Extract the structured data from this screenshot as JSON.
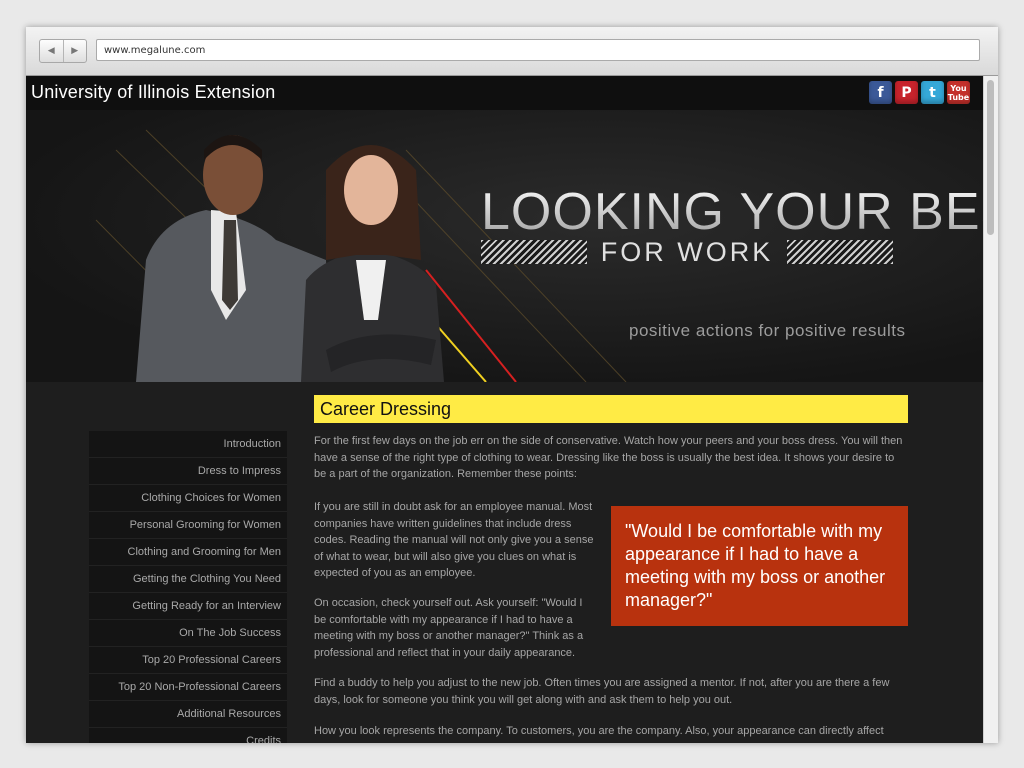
{
  "browser": {
    "url": "www.megalune.com",
    "back_glyph": "◀",
    "forward_glyph": "▶"
  },
  "header": {
    "site_title": "University of Illinois Extension",
    "social": [
      {
        "name": "facebook-icon",
        "glyph": "f",
        "color": "#3b5998"
      },
      {
        "name": "pinterest-icon",
        "glyph": "P",
        "color": "#c8232c"
      },
      {
        "name": "twitter-icon",
        "glyph": "t",
        "color": "#35a8d8"
      },
      {
        "name": "youtube-icon",
        "glyph_top": "You",
        "glyph_bottom": "Tube",
        "color": "#c4302b"
      }
    ]
  },
  "hero": {
    "title": "LOOKING YOUR BEST",
    "subtitle": "FOR WORK",
    "tagline": "positive actions for positive results"
  },
  "sidebar": {
    "items": [
      "Introduction",
      "Dress to Impress",
      "Clothing Choices for Women",
      "Personal Grooming for Women",
      "Clothing and Grooming for Men",
      "Getting the Clothing You Need",
      "Getting Ready for an Interview",
      "On The Job Success",
      "Top 20 Professional Careers",
      "Top 20 Non-Professional Careers",
      "Additional Resources",
      "Credits"
    ]
  },
  "content": {
    "heading": "Career Dressing",
    "p1": "For the first few days on the job err on the side of conservative. Watch how your peers and your boss dress. You will then have a sense of the right type of clothing to wear. Dressing like the boss is usually the best idea. It shows your desire to be a part of the organization. Remember these points:",
    "p2": "If you are still in doubt ask for an employee manual. Most companies have written guidelines that include dress codes. Reading the manual will not only give you a sense of what to wear, but will also give you clues on what is expected of you as an employee.",
    "p3": "On occasion, check yourself out. Ask yourself: \"Would I be comfortable with my appearance if I had to have a meeting with my boss or another manager?\" Think as a professional and reflect that in your daily appearance.",
    "quote": "\"Would I be comfortable with my appearance if I had to have a meeting with my boss or another manager?\"",
    "p4": "Find a buddy to help you adjust to the new job. Often times you are assigned a mentor. If not, after you are there a few days, look for someone you think you will get along with and ask them to help you out.",
    "p5": "How you look represents the company. To customers, you are the company. Also, your appearance can directly affect your"
  }
}
